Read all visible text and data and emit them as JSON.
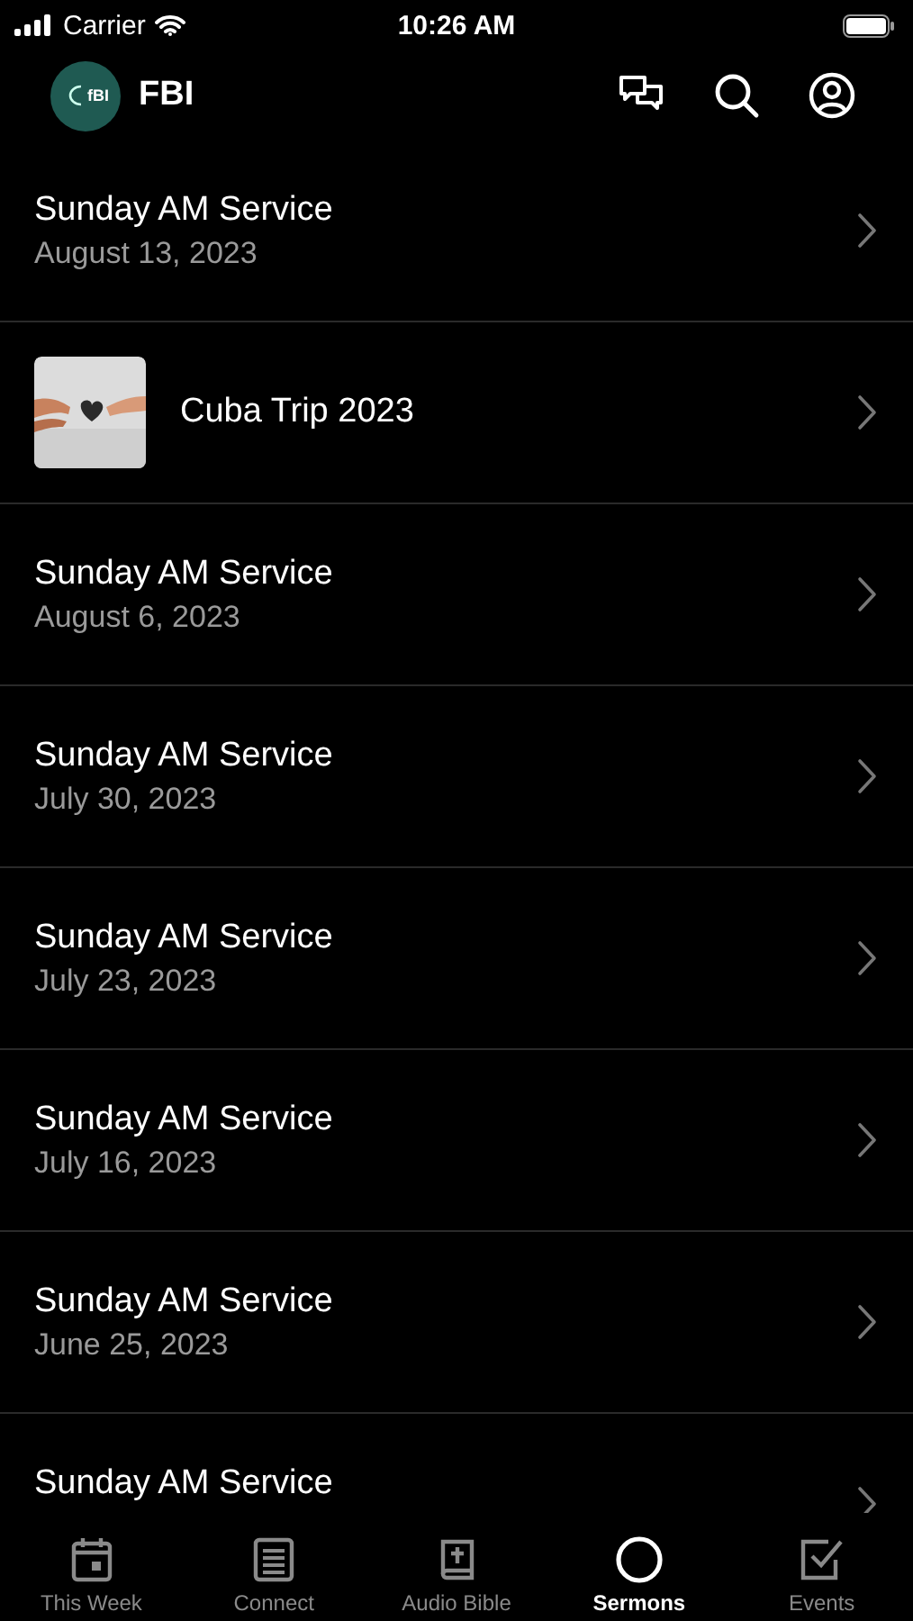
{
  "status_bar": {
    "carrier": "Carrier",
    "time": "10:26 AM"
  },
  "header": {
    "logo_text": "fBI",
    "title": "FBI"
  },
  "rows": [
    {
      "kind": "sermon",
      "title": "Sunday AM Service",
      "subtitle": "August 13, 2023"
    },
    {
      "kind": "series",
      "title": "Cuba Trip 2023"
    },
    {
      "kind": "sermon",
      "title": "Sunday AM Service",
      "subtitle": "August 6, 2023"
    },
    {
      "kind": "sermon",
      "title": "Sunday AM Service",
      "subtitle": "July 30, 2023"
    },
    {
      "kind": "sermon",
      "title": "Sunday AM Service",
      "subtitle": "July 23, 2023"
    },
    {
      "kind": "sermon",
      "title": "Sunday AM Service",
      "subtitle": "July 16, 2023"
    },
    {
      "kind": "sermon",
      "title": "Sunday AM Service",
      "subtitle": "June 25, 2023"
    },
    {
      "kind": "sermon",
      "title": "Sunday AM Service"
    }
  ],
  "tabs": [
    {
      "kind": "calendar",
      "label": "This Week",
      "selected": false
    },
    {
      "kind": "news",
      "label": "Connect",
      "selected": false
    },
    {
      "kind": "bible",
      "label": "Audio Bible",
      "selected": false
    },
    {
      "kind": "circle",
      "label": "Sermons",
      "selected": true
    },
    {
      "kind": "check",
      "label": "Events",
      "selected": false
    }
  ]
}
